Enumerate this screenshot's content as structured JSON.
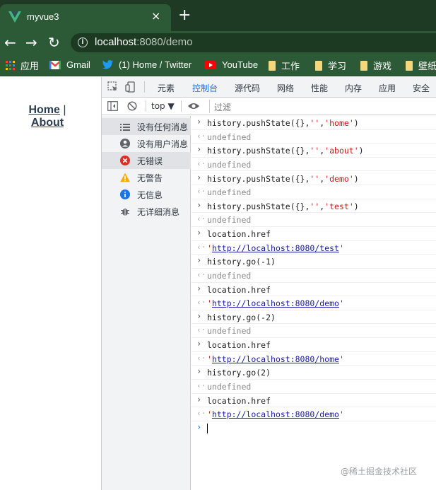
{
  "browser": {
    "tab_title": "myvue3",
    "tab_close": "×",
    "new_tab": "+",
    "url_host": "localhost",
    "url_rest": ":8080/demo"
  },
  "bookmarks": [
    {
      "label": "应用",
      "icon": "apps-grid-icon"
    },
    {
      "label": "Gmail",
      "icon": "gmail-icon"
    },
    {
      "label": "(1) Home / Twitter",
      "icon": "twitter-icon"
    },
    {
      "label": "YouTube",
      "icon": "youtube-icon"
    },
    {
      "label": "工作",
      "icon": "folder-icon"
    },
    {
      "label": "学习",
      "icon": "folder-icon"
    },
    {
      "label": "游戏",
      "icon": "folder-icon"
    },
    {
      "label": "壁纸",
      "icon": "folder-icon"
    }
  ],
  "page": {
    "link_home": "Home",
    "separator": "|",
    "link_about": "About"
  },
  "devtools": {
    "tabs": [
      "元素",
      "控制台",
      "源代码",
      "网络",
      "性能",
      "内存",
      "应用",
      "安全"
    ],
    "active_tab": "控制台",
    "context": "top ▼",
    "filter_placeholder": "过滤",
    "sidebar": [
      {
        "label": "没有任何消息",
        "icon": "list-icon"
      },
      {
        "label": "没有用户消息",
        "icon": "user-icon"
      },
      {
        "label": "无错误",
        "icon": "error-icon"
      },
      {
        "label": "无警告",
        "icon": "warning-icon"
      },
      {
        "label": "无信息",
        "icon": "info-icon"
      },
      {
        "label": "无详细消息",
        "icon": "bug-icon"
      }
    ]
  },
  "console": [
    {
      "type": "input",
      "pre": "history.pushState({},",
      "s1": "''",
      "mid": ",",
      "s2": "'home'",
      "post": ")"
    },
    {
      "type": "result",
      "value": "undefined"
    },
    {
      "type": "input",
      "pre": "history.pushState({},",
      "s1": "''",
      "mid": ",",
      "s2": "'about'",
      "post": ")"
    },
    {
      "type": "result",
      "value": "undefined"
    },
    {
      "type": "input",
      "pre": "history.pushState({},",
      "s1": "''",
      "mid": ",",
      "s2": "'demo'",
      "post": ")"
    },
    {
      "type": "result",
      "value": "undefined"
    },
    {
      "type": "input",
      "pre": "history.pushState({},",
      "s1": "''",
      "mid": ",",
      "s2": "'test'",
      "post": ")"
    },
    {
      "type": "result",
      "value": "undefined"
    },
    {
      "type": "input",
      "code": "location.href"
    },
    {
      "type": "url",
      "value": "http://localhost:8080/test"
    },
    {
      "type": "input",
      "code": "history.go(-1)"
    },
    {
      "type": "result",
      "value": "undefined"
    },
    {
      "type": "input",
      "code": "location.href"
    },
    {
      "type": "url",
      "value": "http://localhost:8080/demo"
    },
    {
      "type": "input",
      "code": "history.go(-2)"
    },
    {
      "type": "result",
      "value": "undefined"
    },
    {
      "type": "input",
      "code": "location.href"
    },
    {
      "type": "url",
      "value": "http://localhost:8080/home"
    },
    {
      "type": "input",
      "code": "history.go(2)"
    },
    {
      "type": "result",
      "value": "undefined"
    },
    {
      "type": "input",
      "code": "location.href"
    },
    {
      "type": "url",
      "value": "http://localhost:8080/demo"
    }
  ],
  "watermark": "@稀土掘金技术社区",
  "colors": {
    "chrome_dark": "#1f3a24",
    "chrome": "#2d5a36",
    "devtools_accent": "#1a73e8",
    "string": "#c41a16",
    "error": "#d93025",
    "warning": "#f9ab00",
    "info": "#1a73e8"
  }
}
